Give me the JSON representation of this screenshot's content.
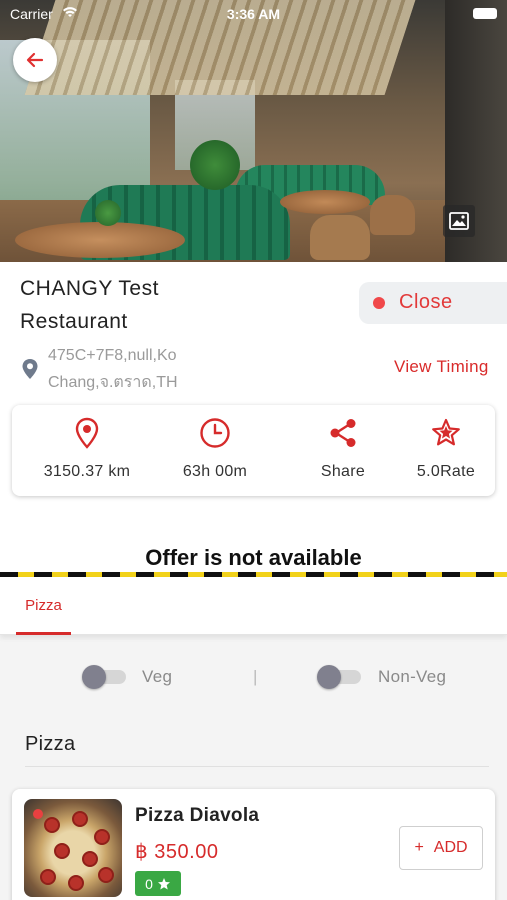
{
  "status_bar": {
    "carrier": "Carrier",
    "time": "3:36 AM"
  },
  "restaurant": {
    "name": "CHANGY Test Restaurant",
    "status": "Close",
    "address": "475C+7F8,null,Ko Chang,จ.ตราด,TH",
    "view_timing_label": "View Timing"
  },
  "stats": [
    {
      "icon": "location-pin-icon",
      "label": "3150.37 km"
    },
    {
      "icon": "clock-icon",
      "label": "63h 00m"
    },
    {
      "icon": "share-icon",
      "label": "Share"
    },
    {
      "icon": "star-icon",
      "label": "5.0Rate"
    }
  ],
  "offer": {
    "text": "Offer is not available"
  },
  "tabs": [
    {
      "label": "Pizza",
      "active": true
    }
  ],
  "filters": {
    "veg_label": "Veg",
    "separator": "|",
    "nonveg_label": "Non-Veg"
  },
  "menu": {
    "section_title": "Pizza",
    "items": [
      {
        "name": "Pizza Diavola",
        "price": "฿ 350.00",
        "rating": "0",
        "add_label": "ADD",
        "add_icon": "+"
      }
    ]
  },
  "colors": {
    "accent": "#d62b2b",
    "status_dot": "#f0484a",
    "rating_green": "#3aa844",
    "stripe_yellow": "#f2d21a"
  }
}
